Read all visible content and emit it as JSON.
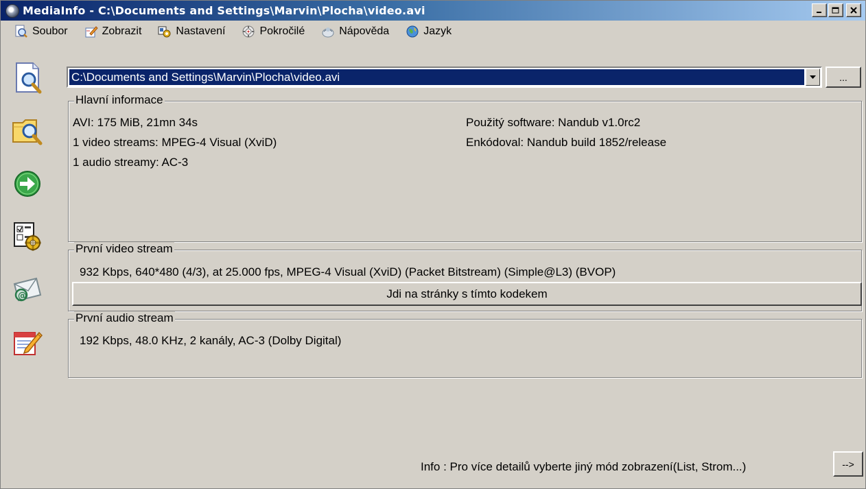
{
  "window": {
    "title": "MediaInfo - C:\\Documents and Settings\\Marvin\\Plocha\\video.avi",
    "minimize": "_",
    "maximize": "□",
    "close": "✕"
  },
  "menu": {
    "items": [
      {
        "label": "Soubor",
        "icon": "file-search-icon"
      },
      {
        "label": "Zobrazit",
        "icon": "pencil-icon"
      },
      {
        "label": "Nastavení",
        "icon": "settings-icon"
      },
      {
        "label": "Pokročilé",
        "icon": "advanced-icon"
      },
      {
        "label": "Nápověda",
        "icon": "help-icon"
      },
      {
        "label": "Jazyk",
        "icon": "globe-icon"
      }
    ]
  },
  "toolbar": {
    "icons": [
      "open-file-icon",
      "open-folder-icon",
      "go-arrow-icon",
      "preferences-icon",
      "email-icon",
      "notepad-icon"
    ]
  },
  "file": {
    "path": "C:\\Documents and Settings\\Marvin\\Plocha\\video.avi",
    "browse_label": "..."
  },
  "general": {
    "title": "Hlavní informace",
    "left": [
      "AVI: 175 MiB, 21mn 34s",
      "1 video streams: MPEG-4 Visual (XviD)",
      "1 audio streamy: AC-3"
    ],
    "right": [
      "Použitý software: Nandub v1.0rc2",
      "Enkódoval: Nandub build 1852/release"
    ]
  },
  "video": {
    "title": "První video stream",
    "info": "932 Kbps, 640*480 (4/3), at 25.000 fps, MPEG-4 Visual (XviD) (Packet Bitstream) (Simple@L3) (BVOP)",
    "codec_button": "Jdi na stránky s tímto kodekem"
  },
  "audio": {
    "title": "První audio stream",
    "info": "192 Kbps, 48.0 KHz, 2 kanály, AC-3 (Dolby Digital)"
  },
  "status": {
    "text": "Info : Pro více detailů vyberte jiný mód zobrazení(List, Strom...)",
    "next_label": "-->"
  },
  "colors": {
    "title_gradient_start": "#0a246a",
    "title_gradient_end": "#a6caf0",
    "selection": "#0a246a",
    "face": "#d4d0c8"
  }
}
